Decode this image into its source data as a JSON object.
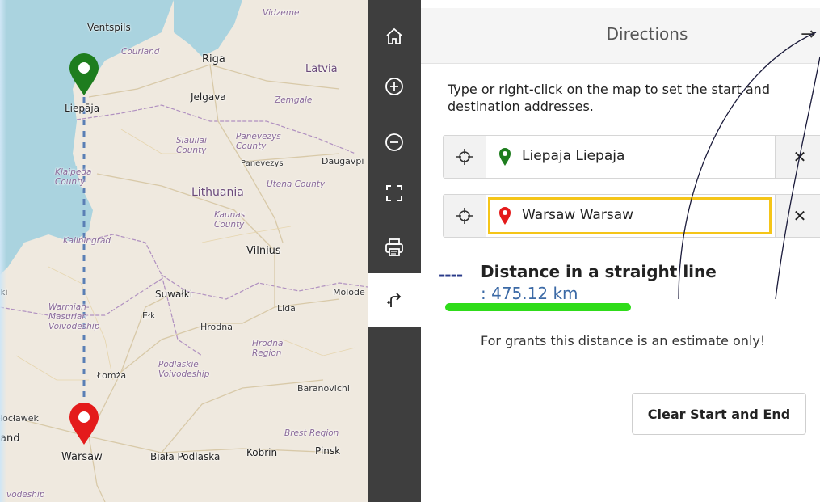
{
  "map": {
    "labels": {
      "vidzeme": "Vidzeme",
      "ventspils": "Ventspils",
      "courland": "Courland",
      "riga": "Riga",
      "latvia": "Latvia",
      "jelgava": "Jelgava",
      "zemgale": "Zemgale",
      "liepaja": "Liepāja",
      "siauliai": "Siauliai\nCounty",
      "panevezys_county": "Panevezys\nCounty",
      "panevezys": "Panevezys",
      "daugavpils": "Daugavpi",
      "klaipeda": "Klaipeda\nCounty",
      "lithuania": "Lithuania",
      "utena": "Utena County",
      "kaunas": "Kaunas\nCounty",
      "kaliningrad": "Kaliningrad",
      "vilnius": "Vilnius",
      "suwalki": "Suwałki",
      "molode": "Molode",
      "warmian": "Warmian-\nMasurian\nVoivodeship",
      "elk": "Ełk",
      "lida": "Lida",
      "hrodna": "Hrodna",
      "hrodna_region": "Hrodna\nRegion",
      "podlaskie": "Podlaskie\nVoivodeship",
      "lomza": "Łomża",
      "baranovichi": "Baranovichi",
      "wloclawek": "łocławek",
      "and": "and",
      "brest_region": "Brest Region",
      "warsaw": "Warsaw",
      "biala": "Biała Podlaska",
      "kobrin": "Kobrin",
      "pinsk": "Pinsk",
      "voivodeship_bottom": "vodeship",
      "ki": "ki"
    },
    "colors": {
      "start_marker": "#1e7d1e",
      "end_marker": "#e41b1b",
      "route_line": "#5a7fb5",
      "sea": "#aad3df"
    }
  },
  "toolbar": {
    "buttons": [
      {
        "name": "home-icon",
        "active": false
      },
      {
        "name": "zoom-in-icon",
        "active": false
      },
      {
        "name": "zoom-out-icon",
        "active": false
      },
      {
        "name": "fullscreen-icon",
        "active": false
      },
      {
        "name": "print-icon",
        "active": false
      },
      {
        "name": "directions-icon",
        "active": true
      }
    ]
  },
  "panel": {
    "title": "Directions",
    "close_icon": "→",
    "instructions": "Type or right-click on the map to set the start and destination addresses.",
    "start": {
      "value": "Liepaja  Liepaja"
    },
    "end": {
      "value": "Warsaw  Warsaw"
    },
    "clear_icon": "✕",
    "distance": {
      "legend": "----",
      "title": "Distance in a straight line",
      "colon": ": ",
      "value": "475.12 km"
    },
    "estimate_note": "For grants this distance is an estimate only!",
    "clear_button": "Clear Start and End"
  }
}
